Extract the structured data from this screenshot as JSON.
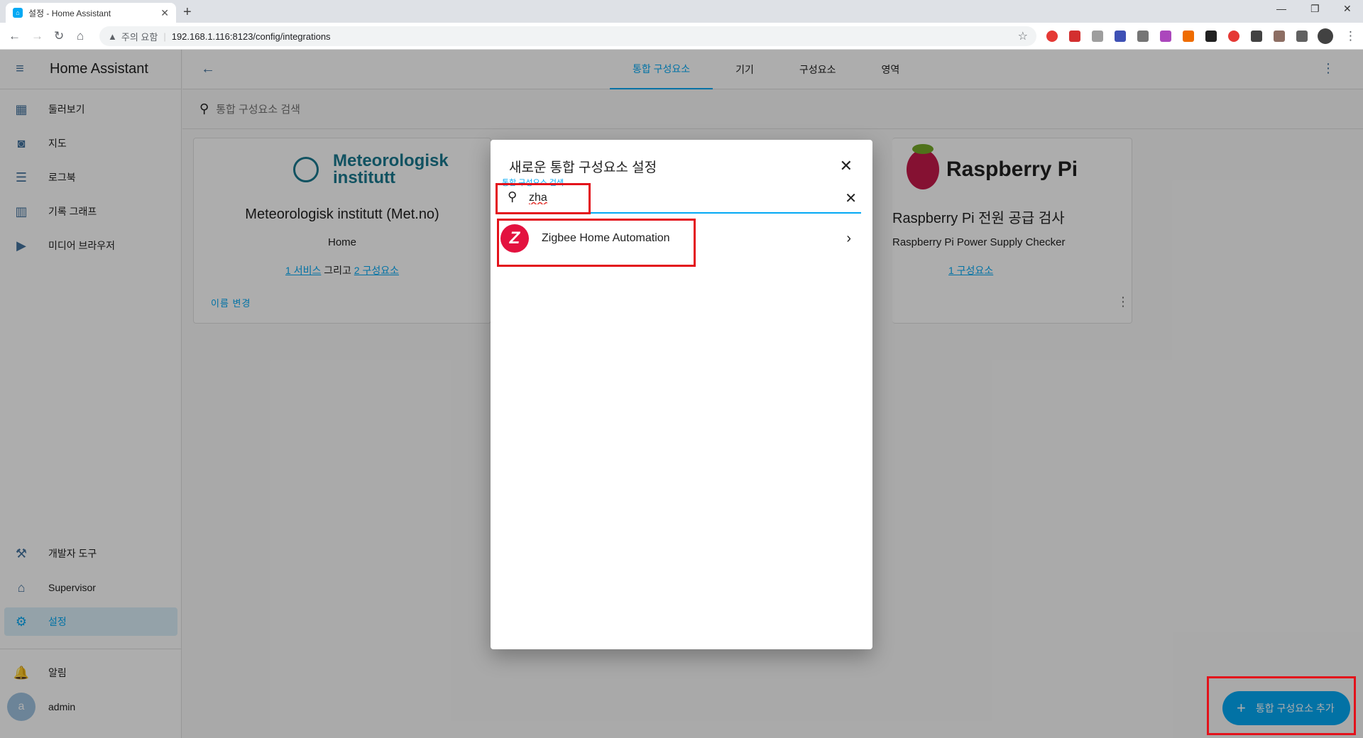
{
  "browser": {
    "tab_title": "설정 - Home Assistant",
    "tab_close": "✕",
    "new_tab": "+",
    "warning_label": "주의 요함",
    "url": "192.168.1.116:8123/config/integrations"
  },
  "sidebar": {
    "title": "Home Assistant",
    "items": [
      {
        "label": "둘러보기",
        "icon": "dashboard-icon"
      },
      {
        "label": "지도",
        "icon": "map-icon"
      },
      {
        "label": "로그북",
        "icon": "logbook-icon"
      },
      {
        "label": "기록 그래프",
        "icon": "history-icon"
      },
      {
        "label": "미디어 브라우저",
        "icon": "media-icon"
      }
    ],
    "bottom_items": [
      {
        "label": "개발자 도구",
        "icon": "hammer-icon"
      },
      {
        "label": "Supervisor",
        "icon": "supervisor-icon"
      },
      {
        "label": "설정",
        "icon": "gear-icon"
      }
    ],
    "notifications": "알림",
    "user_initial": "a",
    "user_name": "admin"
  },
  "toolbar": {
    "tabs": [
      "통합 구성요소",
      "기기",
      "구성요소",
      "영역"
    ],
    "active_tab": "통합 구성요소"
  },
  "search": {
    "placeholder": "통합 구성요소 검색"
  },
  "cards": [
    {
      "logo_text_line1": "Meteorologisk",
      "logo_text_line2": "institutt",
      "title": "Meteorologisk institutt (Met.no)",
      "subtitle": "Home",
      "link1": "1 서비스",
      "conjunction": "그리고",
      "link2": "2 구성요소",
      "rename": "이름 변경"
    },
    {
      "logo_text": "Raspberry Pi",
      "title": "Raspberry Pi 전원 공급 검사",
      "subtitle": "Raspberry Pi Power Supply Checker",
      "link1": "1 구성요소"
    }
  ],
  "dialog": {
    "title": "새로운 통합 구성요소 설정",
    "search_label": "통합 구성요소 검색",
    "search_value": "zha",
    "result": {
      "name": "Zigbee Home Automation",
      "logo_letter": "Z"
    }
  },
  "fab": {
    "label": "통합 구성요소 추가"
  },
  "colors": {
    "primary": "#03a9f4",
    "sidebar_icon": "#44739e",
    "highlight": "#e3121b",
    "zigbee": "#e3123f"
  }
}
